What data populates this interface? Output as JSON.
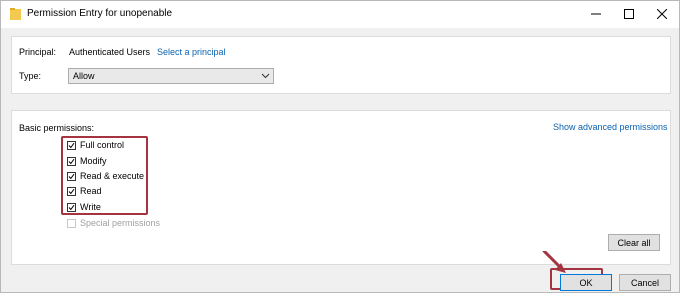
{
  "window": {
    "title": "Permission Entry for unopenable"
  },
  "principal": {
    "label": "Principal:",
    "value": "Authenticated Users",
    "link": "Select a principal"
  },
  "type": {
    "label": "Type:",
    "selected": "Allow"
  },
  "permissions": {
    "header": "Basic permissions:",
    "advanced_link": "Show advanced permissions",
    "items": [
      {
        "label": "Full control",
        "checked": true
      },
      {
        "label": "Modify",
        "checked": true
      },
      {
        "label": "Read & execute",
        "checked": true
      },
      {
        "label": "Read",
        "checked": true
      },
      {
        "label": "Write",
        "checked": true
      }
    ],
    "special": {
      "label": "Special permissions",
      "checked": false,
      "disabled": true
    },
    "clear_all": "Clear all"
  },
  "buttons": {
    "ok": "OK",
    "cancel": "Cancel"
  },
  "colors": {
    "annotation": "#a4343f",
    "link": "#0b62b0",
    "default_button_border": "#0078d7"
  }
}
